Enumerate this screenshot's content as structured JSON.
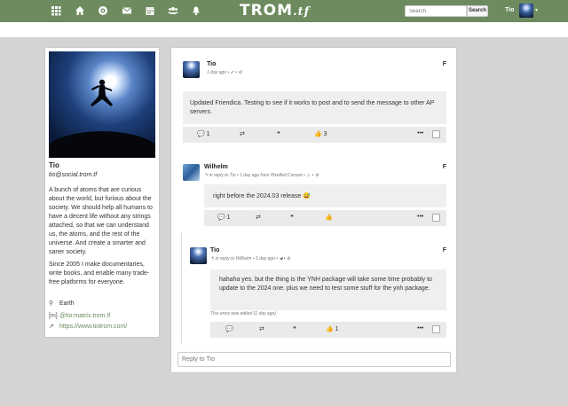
{
  "nav": {
    "icons": [
      "network-icon",
      "home-icon",
      "community-icon",
      "messages-icon",
      "calendar-icon",
      "contacts-icon",
      "notifications-icon"
    ],
    "logo_main": "TROM",
    "logo_suffix": ".tf",
    "search_placeholder": "Search",
    "search_button": "Search",
    "user_name": "Tio",
    "accent": "#6d8b5e"
  },
  "profile": {
    "name": "Tio",
    "address": "tio@social.trom.tf",
    "bio": [
      "A bunch of atoms that are curious about the world, but furious about the society. We should help all humans to have a decent life without any strings attached, so that we can understand us, the atoms, and the rest of the universe. And create a smarter and saner society.",
      "Since 2005 I make documentaries, write books, and enable many trade-free platforms for everyone."
    ],
    "location": "Earth",
    "matrix": "@tio:matrix.trom.tf",
    "website": "https://www.tiotrom.com/"
  },
  "posts": [
    {
      "author": "Tio",
      "meta": "1 day ago • ✔ • ⚙",
      "body": "Updated Friendica. Testing to see if it works to post and to send the message to other AP servers.",
      "comments": "1",
      "likes": "3"
    },
    {
      "author": "Wilhelm",
      "meta": "↰ in reply to Tio • 1 day ago from Pixelfed Currant • ☺ • ⚙",
      "body": "right before the 2024.03 release 😅",
      "comments": "1"
    },
    {
      "author": "Tio",
      "meta": "↰ in reply to Wilhelm • 1 day ago • ◀ • ⚙",
      "body": "hahaha yes. but the thing is the YNH package will take some time probably to update to the 2024 one. plus we need to test some stuff for the ynh package.",
      "edited": "This entry was edited (1 day ago)",
      "likes": "1"
    }
  ],
  "reply_placeholder": "Reply to Tio"
}
